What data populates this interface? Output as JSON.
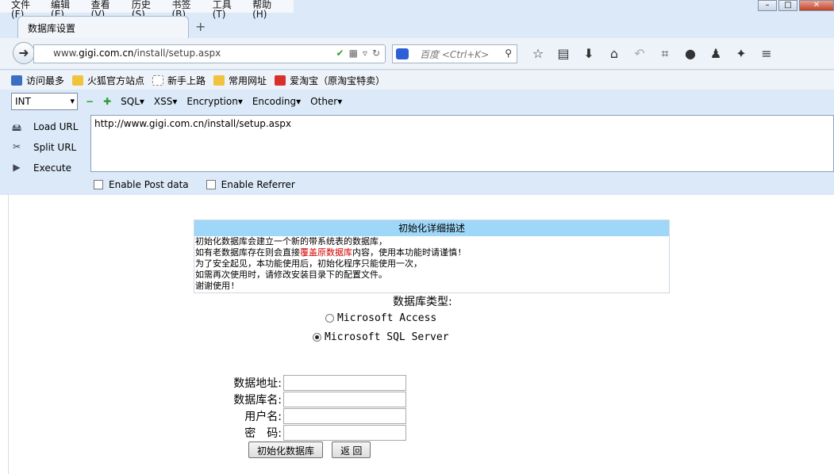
{
  "menubar": [
    "文件(F)",
    "编辑(E)",
    "查看(V)",
    "历史(S)",
    "书签(B)",
    "工具(T)",
    "帮助(H)"
  ],
  "tab": {
    "title": "数据库设置",
    "new_tab": "+"
  },
  "nav": {
    "url_prefix": "www.",
    "url_host": "gigi.com.cn",
    "url_path": "/install/setup.aspx",
    "search_placeholder": "百度 <Ctrl+K>"
  },
  "bookmarks": [
    {
      "label": "访问最多",
      "color": "#3b6fc2"
    },
    {
      "label": "火狐官方站点",
      "color": "#f0c33c"
    },
    {
      "label": "新手上路",
      "color": "#ffffff"
    },
    {
      "label": "常用网址",
      "color": "#f0c33c"
    },
    {
      "label": "爱淘宝（原淘宝特卖）",
      "color": "#d9302c"
    }
  ],
  "hackbar": {
    "select_value": "INT",
    "menu": [
      "SQL▾",
      "XSS▾",
      "Encryption▾",
      "Encoding▾",
      "Other▾"
    ],
    "load_url": "Load URL",
    "split_url": "Split URL",
    "execute": "Execute",
    "url_value": "http://www.gigi.com.cn/install/setup.aspx",
    "enable_post": "Enable Post data",
    "enable_referrer": "Enable Referrer"
  },
  "page": {
    "desc_title": "初始化详细描述",
    "desc_line1": "初始化数据库会建立一个新的带系统表的数据库，",
    "desc_line2_a": "如有老数据库存在则会直接",
    "desc_line2_red": "覆盖原数据库",
    "desc_line2_b": "内容，使用本功能时请谨慎!",
    "desc_line3": "为了安全起见，本功能使用后，初始化程序只能使用一次，",
    "desc_line4": "如需再次使用时，请修改安装目录下的配置文件。",
    "desc_line5": "谢谢使用!",
    "db_type_label": "数据库类型:",
    "option_access": "Microsoft Access",
    "option_sql": "Microsoft SQL Server",
    "selected_option": "Microsoft SQL Server",
    "field_server": "数据地址:",
    "field_dbname": "数据库名:",
    "field_user": "用户名:",
    "field_password": "密　码:",
    "btn_init": "初始化数据库",
    "btn_back": "返 回"
  }
}
